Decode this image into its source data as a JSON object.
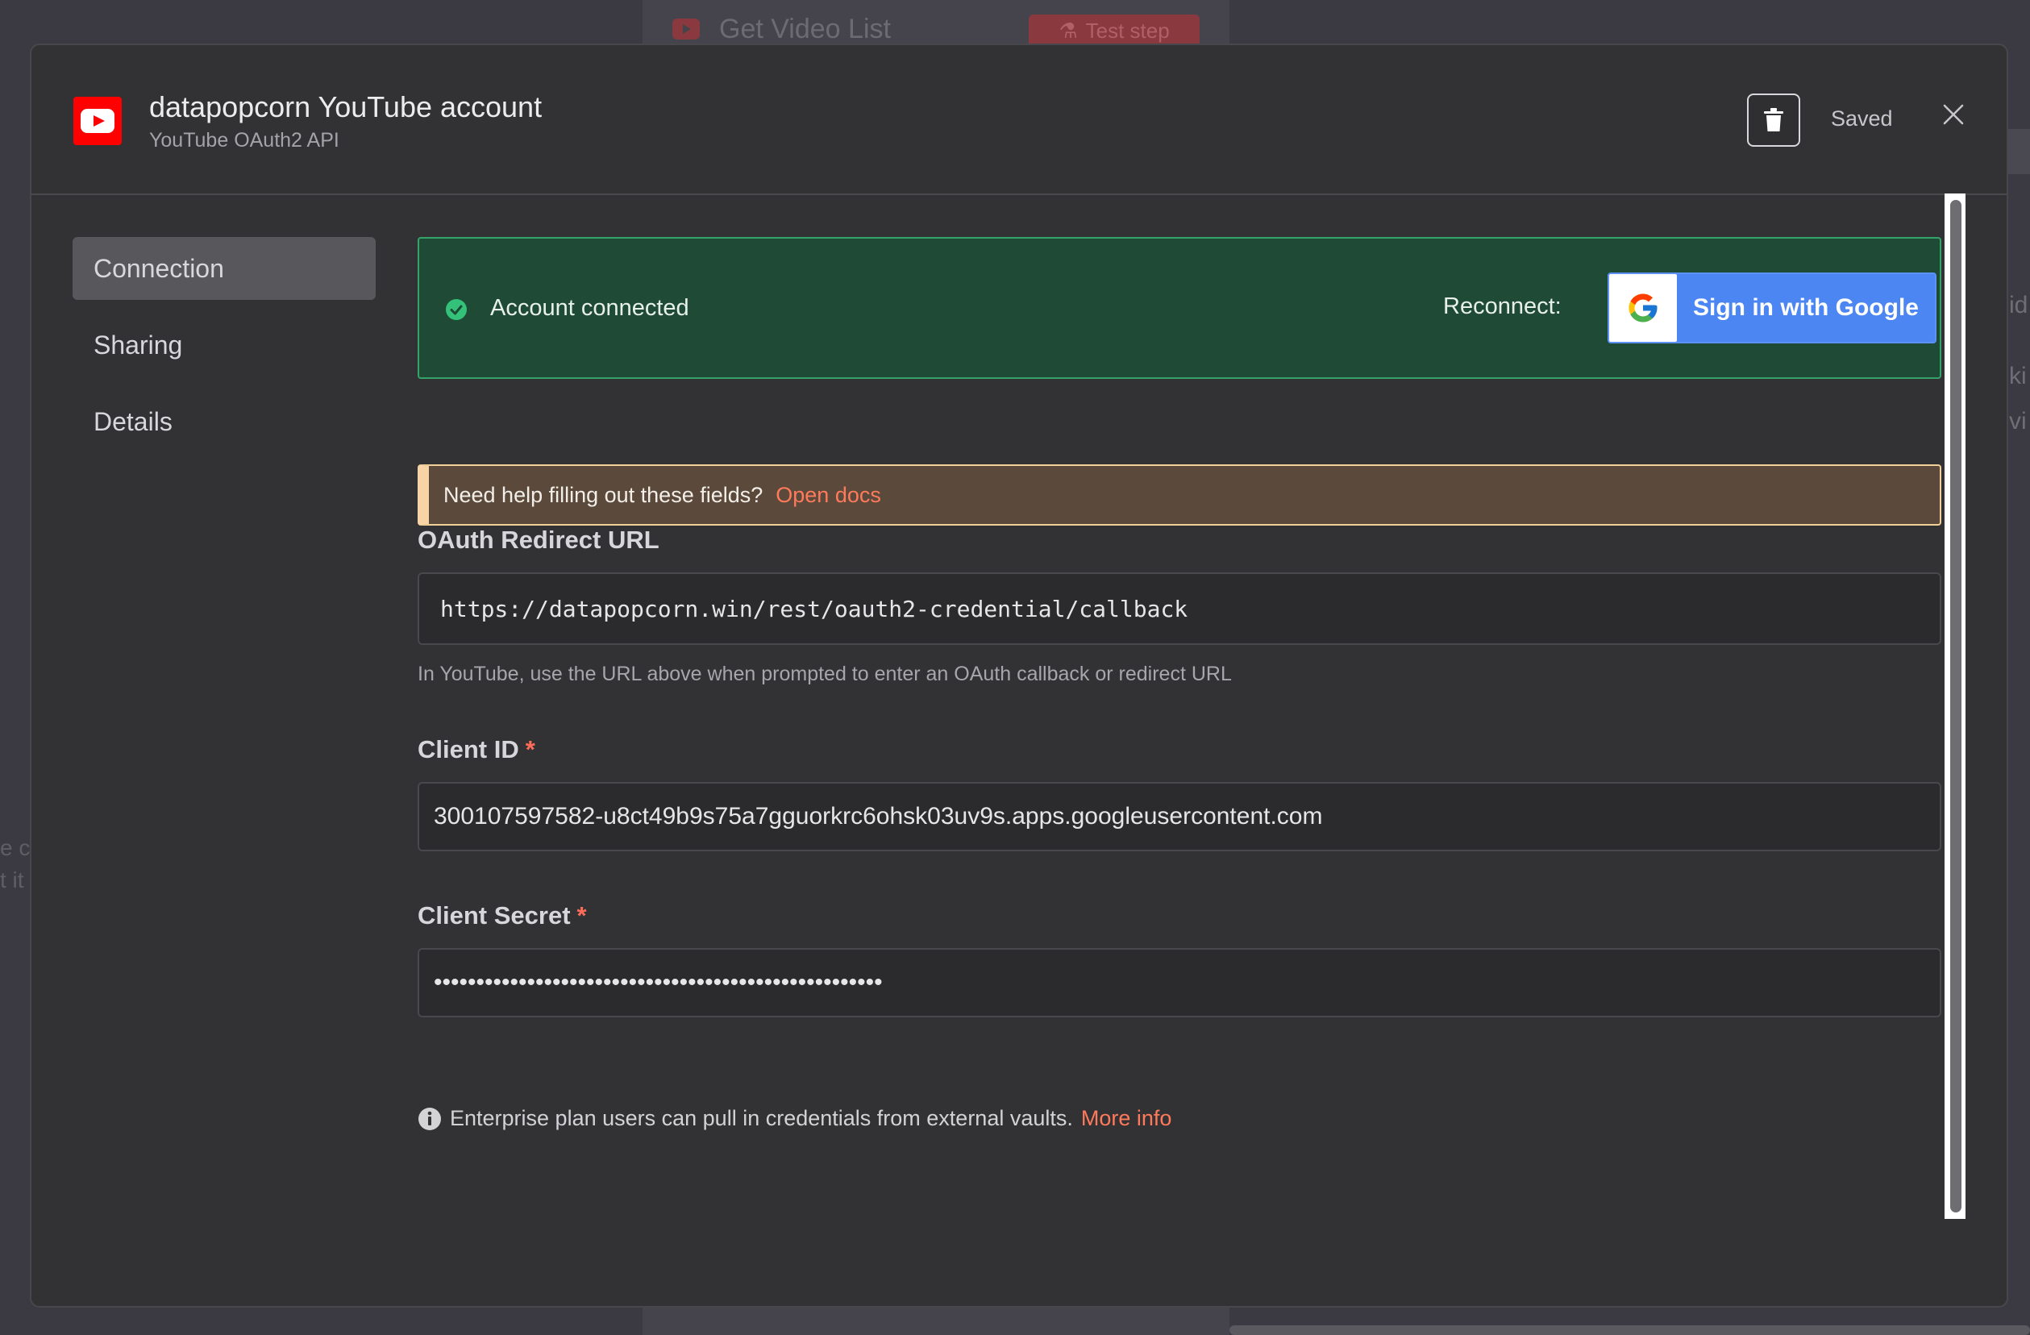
{
  "background": {
    "node_title": "Get Video List",
    "test_step_label": "Test step",
    "right_fragments": [
      "id",
      "ki",
      "vi"
    ],
    "left_fragments": [
      "e c",
      "t it"
    ]
  },
  "header": {
    "title": "datapopcorn YouTube account",
    "subtitle": "YouTube OAuth2 API",
    "saved_label": "Saved"
  },
  "sidebar": {
    "items": [
      {
        "label": "Connection",
        "active": true
      },
      {
        "label": "Sharing",
        "active": false
      },
      {
        "label": "Details",
        "active": false
      }
    ]
  },
  "status": {
    "connected_text": "Account connected",
    "reconnect_label": "Reconnect:",
    "google_button_label": "Sign in with Google"
  },
  "docs_banner": {
    "text": "Need help filling out these fields?",
    "link": "Open docs"
  },
  "fields": {
    "redirect_url": {
      "label": "OAuth Redirect URL",
      "value": "https://datapopcorn.win/rest/oauth2-credential/callback",
      "hint": "In YouTube, use the URL above when prompted to enter an OAuth callback or redirect URL"
    },
    "client_id": {
      "label": "Client ID",
      "required_mark": "*",
      "value": "300107597582-u8ct49b9s75a7gguorkrc6ohsk03uv9s.apps.googleusercontent.com"
    },
    "client_secret": {
      "label": "Client Secret",
      "required_mark": "*",
      "value": "•••••••••••••••••••••••••••••••••••••••••••••••••••••"
    }
  },
  "enterprise_note": {
    "text": "Enterprise plan users can pull in credentials from external vaults.",
    "link": "More info"
  },
  "colors": {
    "accent": "#ff6d5a",
    "success": "#34a36a",
    "google_blue": "#4b86f2",
    "youtube_red": "#ff0000"
  },
  "icons": [
    "youtube-logo-icon",
    "trash-icon",
    "close-icon",
    "check-circle-icon",
    "google-logo-icon",
    "info-icon"
  ]
}
